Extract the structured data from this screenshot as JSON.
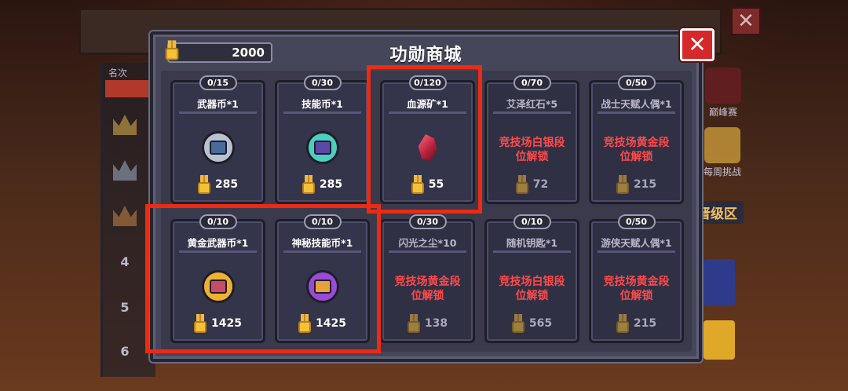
{
  "background": {
    "rank_header": "名次",
    "ranks": [
      "4",
      "5",
      "6"
    ],
    "side_items": [
      "巅峰赛",
      "每周挑战"
    ],
    "zone_label": "晋级区",
    "close_label": "✕"
  },
  "shop": {
    "title": "功勋商城",
    "currency_amount": "2000",
    "close_label": "✕",
    "colors": {
      "accent_red": "#ee2a12",
      "locked_text": "#ff4a4a",
      "medal_gold": "#f4c23a"
    },
    "items": [
      {
        "stock": "0/15",
        "name": "武器币*1",
        "price": "285",
        "locked": false,
        "icon": "weapon-coin-icon",
        "icon_color": "#b9c2d0",
        "inner_color": "#4a6a9a"
      },
      {
        "stock": "0/30",
        "name": "技能币*1",
        "price": "285",
        "locked": false,
        "icon": "skill-coin-icon",
        "icon_color": "#4ad0c0",
        "inner_color": "#5a4aa8"
      },
      {
        "stock": "0/120",
        "name": "血源矿*1",
        "price": "55",
        "locked": false,
        "icon": "blood-ore-icon"
      },
      {
        "stock": "0/70",
        "name": "艾泽红石*5",
        "price": "72",
        "locked": true,
        "lock_line1": "竞技场白银段",
        "lock_line2": "位解锁"
      },
      {
        "stock": "0/50",
        "name": "战士天赋人偶*1",
        "price": "215",
        "locked": true,
        "lock_line1": "竞技场黄金段",
        "lock_line2": "位解锁"
      },
      {
        "stock": "0/10",
        "name": "黄金武器币*1",
        "price": "1425",
        "locked": false,
        "icon": "gold-weapon-coin-icon",
        "icon_color": "#f0b030",
        "inner_color": "#c84a6a"
      },
      {
        "stock": "0/10",
        "name": "神秘技能币*1",
        "price": "1425",
        "locked": false,
        "icon": "mystery-skill-coin-icon",
        "icon_color": "#9a4ad8",
        "inner_color": "#e8a040"
      },
      {
        "stock": "0/30",
        "name": "闪光之尘*10",
        "price": "138",
        "locked": true,
        "lock_line1": "竞技场黄金段",
        "lock_line2": "位解锁"
      },
      {
        "stock": "0/10",
        "name": "随机钥匙*1",
        "price": "565",
        "locked": true,
        "lock_line1": "竞技场白银段",
        "lock_line2": "位解锁"
      },
      {
        "stock": "0/50",
        "name": "游侠天赋人偶*1",
        "price": "215",
        "locked": true,
        "lock_line1": "竞技场黄金段",
        "lock_line2": "位解锁"
      }
    ]
  }
}
